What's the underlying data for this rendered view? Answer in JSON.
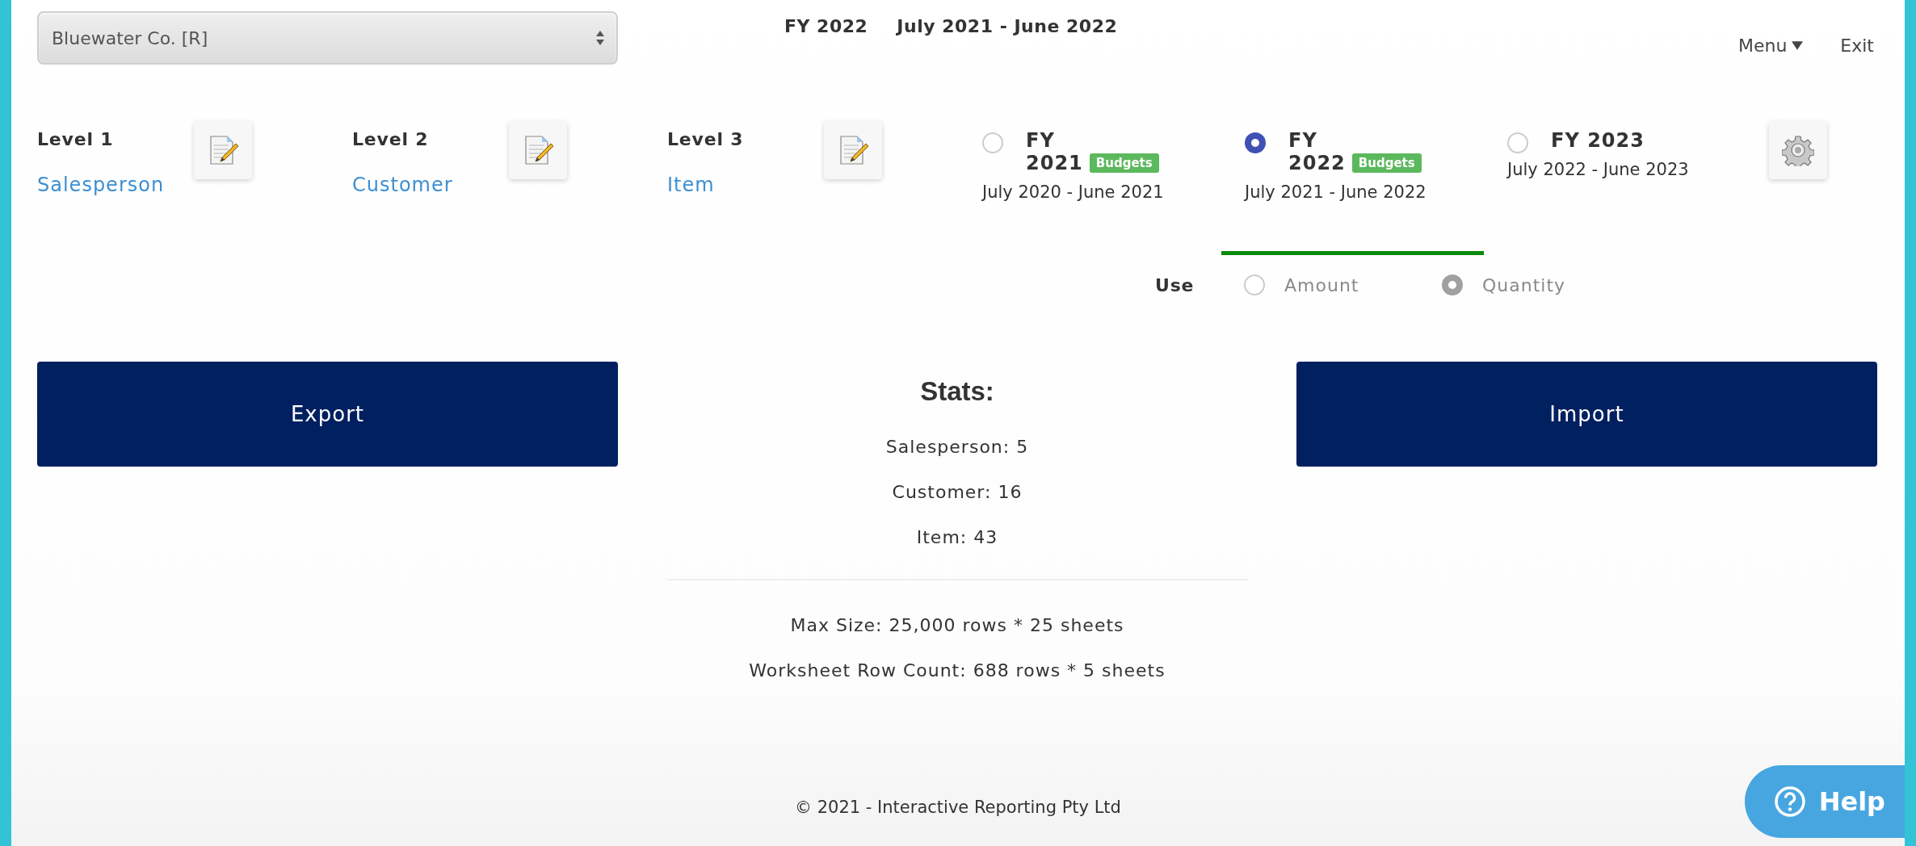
{
  "company_select": {
    "value": "Bluewater Co. [R]"
  },
  "header": {
    "fiscal_year": "FY 2022",
    "period": "July 2021 - June 2022"
  },
  "nav": [
    {
      "label": "Menu",
      "kind": "dropdown"
    },
    {
      "label": "Exit",
      "kind": "link"
    }
  ],
  "levels": [
    {
      "label": "Level 1",
      "value": "Salesperson"
    },
    {
      "label": "Level 2",
      "value": "Customer"
    },
    {
      "label": "Level 3",
      "value": "Item"
    }
  ],
  "fiscal_years": [
    {
      "title": "FY 2021",
      "badge": "Budgets",
      "period": "July 2020 - June 2021",
      "selected": false
    },
    {
      "title": "FY 2022",
      "badge": "Budgets",
      "period": "July 2021 - June 2022",
      "selected": true
    },
    {
      "title": "FY 2023",
      "period": "July 2022 - June 2023",
      "selected": false
    }
  ],
  "use": {
    "label": "Use",
    "options": [
      {
        "label": "Amount",
        "selected": false,
        "disabled": true
      },
      {
        "label": "Quantity",
        "selected": true,
        "disabled": true
      }
    ]
  },
  "buttons": [
    "Export",
    "Import"
  ],
  "stats": {
    "title": "Stats:",
    "lines": [
      "Salesperson: 5",
      "Customer: 16",
      "Item: 43"
    ]
  },
  "limits": [
    "Max Size: 25,000 rows * 25 sheets",
    "Worksheet Row Count: 688 rows * 5 sheets"
  ],
  "footer": "© 2021 - Interactive Reporting Pty Ltd",
  "help_button": "Help"
}
